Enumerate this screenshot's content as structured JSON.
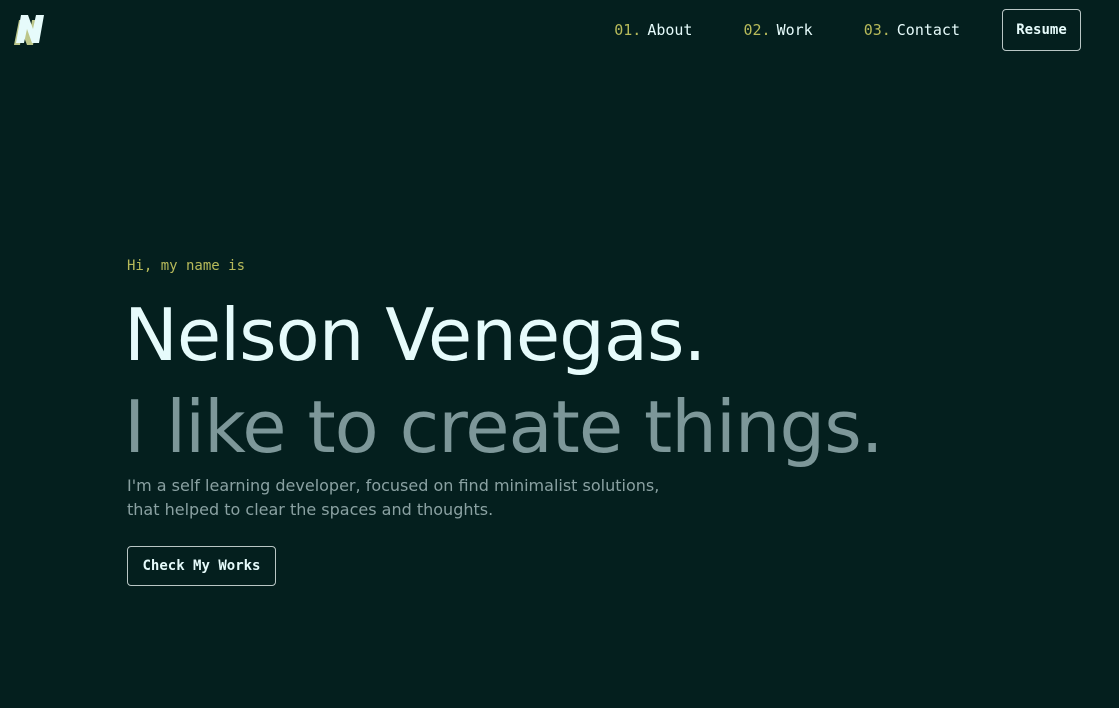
{
  "header": {
    "nav": [
      {
        "number": "01.",
        "label": "About"
      },
      {
        "number": "02.",
        "label": "Work"
      },
      {
        "number": "03.",
        "label": "Contact"
      }
    ],
    "resume_label": "Resume"
  },
  "hero": {
    "greeting": "Hi, my name is",
    "name": "Nelson Venegas.",
    "tagline": "I like to create things.",
    "description_line1": "I'm a self learning developer, focused on find minimalist solutions,",
    "description_line2": "that helped to clear the spaces and thoughts.",
    "cta_label": "Check My Works"
  },
  "colors": {
    "background": "#041f1e",
    "text": "#e6fbfb",
    "accent": "#b7ba5a",
    "muted": "#7d9799"
  },
  "icons": {
    "logo": "letter-n-logo-icon"
  }
}
